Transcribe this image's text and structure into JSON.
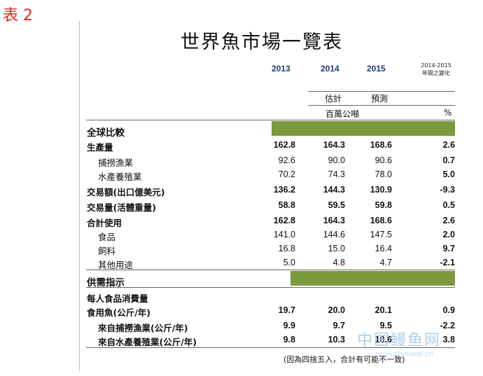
{
  "tag": "表 2",
  "title": "世界魚市場一覽表",
  "years": [
    "2013",
    "2014",
    "2015"
  ],
  "change_header": [
    "2014-2015",
    "年間之變化"
  ],
  "estimate_label": "估計",
  "forecast_label": "預測",
  "unit_label": "百萬公噸",
  "pct_label": "%",
  "section1_title": "全球比較",
  "section2_title": "供需指示",
  "rows1": [
    {
      "label": "生產量",
      "values": [
        "162.8",
        "164.3",
        "168.6",
        "2.6"
      ]
    },
    {
      "label": "捕撈漁業",
      "values": [
        "92.6",
        "90.0",
        "90.6",
        "0.7"
      ]
    },
    {
      "label": "水產養殖業",
      "values": [
        "70.2",
        "74.3",
        "78.0",
        "5.0"
      ]
    },
    {
      "label": "交易額(出口億美元)",
      "values": [
        "136.2",
        "144.3",
        "130.9",
        "-9.3"
      ]
    },
    {
      "label": "交易量(活體重量)",
      "values": [
        "58.8",
        "59.5",
        "59.8",
        "0.5"
      ]
    },
    {
      "label": "合計使用",
      "values": [
        "162.8",
        "164.3",
        "168.6",
        "2.6"
      ]
    },
    {
      "label": "食品",
      "values": [
        "141.0",
        "144.6",
        "147.5",
        "2.0"
      ]
    },
    {
      "label": "飼料",
      "values": [
        "16.8",
        "15.0",
        "16.4",
        "9.7"
      ]
    },
    {
      "label": "其他用途",
      "values": [
        "5.0",
        "4.8",
        "4.7",
        "-2.1"
      ]
    }
  ],
  "rows2": [
    {
      "label": "每人食品消費量",
      "values": [
        "",
        "",
        "",
        ""
      ]
    },
    {
      "label": "食用魚(公斤/年)",
      "values": [
        "19.7",
        "20.0",
        "20.1",
        "0.9"
      ]
    },
    {
      "label": "來自捕撈漁業(公斤/年)",
      "values": [
        "9.9",
        "9.7",
        "9.5",
        "-2.2"
      ]
    },
    {
      "label": "來自水產養殖業(公斤/年)",
      "values": [
        "9.8",
        "10.3",
        "10.6",
        "3.8"
      ]
    }
  ],
  "footnote": "(因為四捨五入，合計有可能不一致)",
  "watermark_cn": "中国鳗鱼网",
  "watermark_url": "www.chinaeel.cn",
  "colors": {
    "band": "#7a9a3c",
    "year": "#1f3d74",
    "tag": "#e0261b"
  }
}
